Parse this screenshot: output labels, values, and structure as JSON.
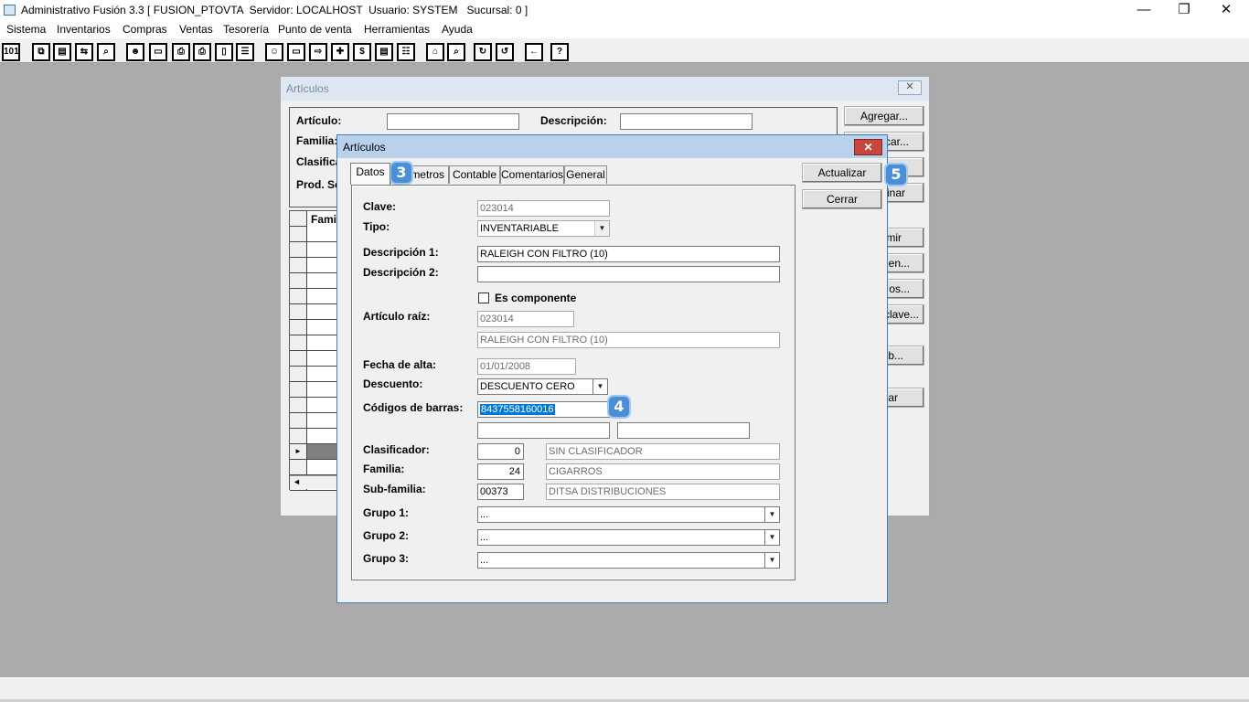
{
  "window": {
    "title": "Administrativo Fusión 3.3 [ FUSION_PTOVTA  Servidor: LOCALHOST  Usuario: SYSTEM   Sucursal: 0 ]",
    "minimize": "—",
    "restore": "❐",
    "close": "✕"
  },
  "menu": [
    "Sistema",
    "Inventarios",
    "Compras",
    "Ventas",
    "Tesorería",
    "Punto de venta",
    "Herramientas",
    "Ayuda"
  ],
  "toolbar": {
    "icons": [
      "calendar-icon",
      "copy-icon",
      "clipboard-icon",
      "swap-icon",
      "search-icon",
      "user-icon",
      "folder-icon",
      "print-icon",
      "print-preview-icon",
      "document-icon",
      "list-icon",
      "people-icon",
      "box-icon",
      "export-icon",
      "add-icon",
      "money-icon",
      "report-icon",
      "table-icon",
      "home-icon",
      "zoom-icon",
      "refresh-icon",
      "undo-icon",
      "back-icon",
      "help-icon"
    ],
    "glyphs": [
      "101",
      "⧉",
      "▤",
      "⇆",
      "⌕",
      "☻",
      "▭",
      "⎙",
      "⎙",
      "▯",
      "☰",
      "☺☺",
      "▭",
      "⇨",
      "✚",
      "$",
      "▤",
      "☷",
      "⌂",
      "⌕",
      "↻",
      "↺",
      "←",
      "?"
    ]
  },
  "bg_window": {
    "title": "Artículos",
    "close": "✕",
    "labels": {
      "articulo": "Artículo:",
      "descripcion": "Descripción:",
      "familia": "Familia:",
      "clasifica": "Clasifica",
      "prodse": "Prod. Se"
    },
    "grid_header": "Fami",
    "buttons": [
      "Agregar...",
      "car...",
      "",
      "inar",
      "mir",
      "en...",
      "os...",
      "clave...",
      "eb...",
      "ar"
    ]
  },
  "dialog": {
    "title": "Artículos",
    "close": "✕",
    "tabs": [
      "Datos",
      "Parámetros",
      "Contable",
      "Comentarios",
      "General"
    ],
    "tab_partial": "ámetros",
    "buttons": {
      "actualizar": "Actualizar",
      "cerrar": "Cerrar"
    },
    "labels": {
      "clave": "Clave:",
      "tipo": "Tipo:",
      "desc1": "Descripción 1:",
      "desc2": "Descripción 2:",
      "es_componente": "Es componente",
      "articulo_raiz": "Artículo raíz:",
      "fecha_alta": "Fecha de alta:",
      "descuento": "Descuento:",
      "codigos": "Códigos de barras:",
      "clasificador": "Clasificador:",
      "familia": "Familia:",
      "subfamilia": "Sub-familia:",
      "grupo1": "Grupo 1:",
      "grupo2": "Grupo 2:",
      "grupo3": "Grupo 3:"
    },
    "values": {
      "clave": "023014",
      "tipo": "INVENTARIABLE",
      "desc1": "RALEIGH CON FILTRO (10)",
      "desc2": "",
      "es_componente": false,
      "raiz_clave": "023014",
      "raiz_desc": "RALEIGH CON FILTRO (10)",
      "fecha_alta": "01/01/2008",
      "descuento": "DESCUENTO CERO",
      "codigo1": "8437558160016",
      "codigo2": "",
      "codigo3": "",
      "clasificador_num": "0",
      "clasificador_desc": "SIN CLASIFICADOR",
      "familia_num": "24",
      "familia_desc": "CIGARROS",
      "subfamilia_num": "00373",
      "subfamilia_desc": "DITSA DISTRIBUCIONES",
      "grupo1": "...",
      "grupo2": "...",
      "grupo3": "..."
    }
  },
  "badges": {
    "b3": "3",
    "b4": "4",
    "b5": "5"
  }
}
